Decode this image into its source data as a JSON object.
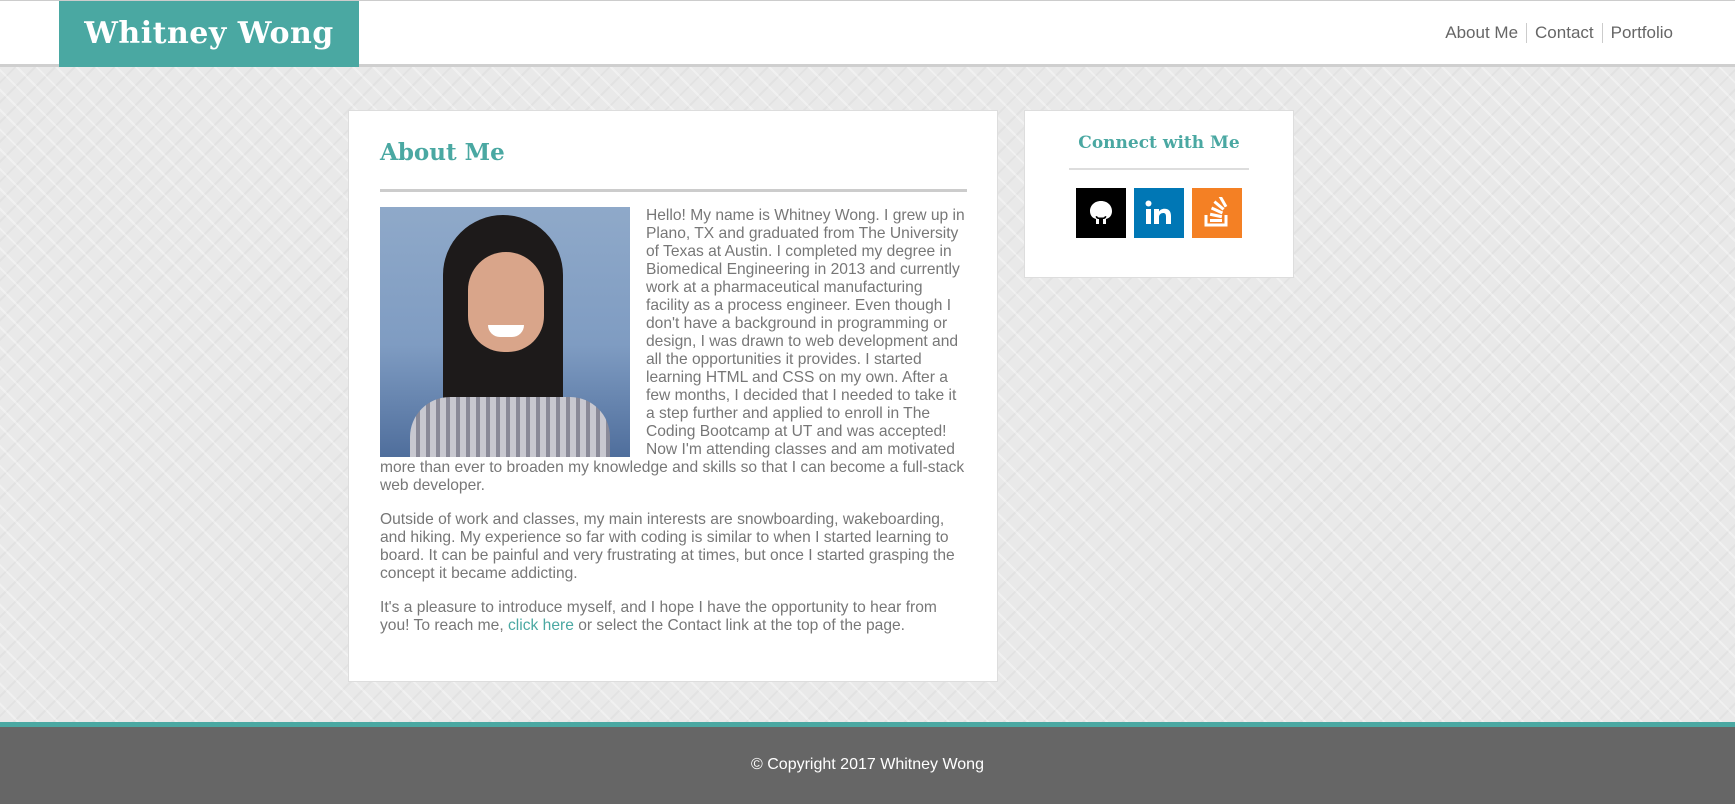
{
  "header": {
    "brand": "Whitney Wong",
    "nav": [
      {
        "label": "About Me"
      },
      {
        "label": "Contact"
      },
      {
        "label": "Portfolio"
      }
    ]
  },
  "main": {
    "title": "About Me",
    "photo_alt": "Whitney Wong",
    "paragraphs": [
      "Hello! My name is Whitney Wong. I grew up in Plano, TX and graduated from The University of Texas at Austin. I completed my degree in Biomedical Engineering in 2013 and currently work at a pharmaceutical manufacturing facility as a process engineer. Even though I don't have a background in programming or design, I was drawn to web development and all the opportunities it provides. I started learning HTML and CSS on my own. After a few months, I decided that I needed to take it a step further and applied to enroll in The Coding Bootcamp at UT and was accepted! Now I'm attending classes and am motivated more than ever to broaden my knowledge and skills so that I can become a full-stack web developer.",
      "Outside of work and classes, my main interests are snowboarding, wakeboarding, and hiking. My experience so far with coding is similar to when I started learning to board. It can be painful and very frustrating at times, but once I started grasping the concept it became addicting."
    ],
    "closing": {
      "before": "It's a pleasure to introduce myself, and I hope I have the opportunity to hear from you! To reach me, ",
      "link": "click here",
      "after": " or select the Contact link at the top of the page."
    }
  },
  "sidebar": {
    "title": "Connect with Me",
    "social": [
      {
        "name": "github-icon",
        "color": "#000000"
      },
      {
        "name": "linkedin-icon",
        "color": "#0077b5"
      },
      {
        "name": "stackoverflow-icon",
        "color": "#f48024"
      }
    ]
  },
  "footer": {
    "text": "© Copyright 2017 Whitney Wong"
  },
  "colors": {
    "accent": "#4aa8a2",
    "footer_bg": "#666666"
  }
}
